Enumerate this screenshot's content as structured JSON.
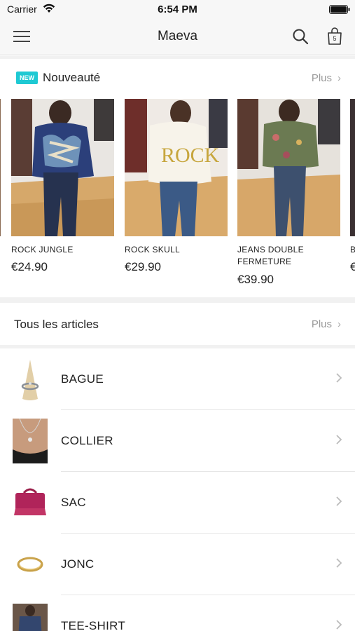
{
  "status_bar": {
    "carrier": "Carrier",
    "time": "6:54 PM"
  },
  "nav": {
    "title": "Maeva",
    "cart_count": "5"
  },
  "new_section": {
    "badge": "NEW",
    "title": "Nouveauté",
    "more_label": "Plus",
    "products": [
      {
        "name": "ROCK JUNGLE",
        "price": "€24.90"
      },
      {
        "name": "ROCK SKULL",
        "price": "€29.90"
      },
      {
        "name": "JEANS DOUBLE FERMETURE",
        "price": "€39.90"
      },
      {
        "name": "B",
        "price": "€"
      }
    ]
  },
  "all_articles": {
    "title": "Tous les articles",
    "more_label": "Plus",
    "categories": [
      {
        "label": "BAGUE"
      },
      {
        "label": "COLLIER"
      },
      {
        "label": "SAC"
      },
      {
        "label": "JONC"
      },
      {
        "label": "TEE-SHIRT"
      }
    ]
  }
}
